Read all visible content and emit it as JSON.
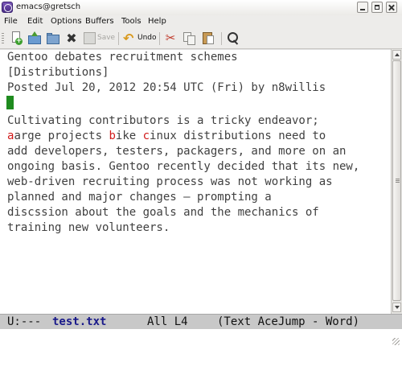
{
  "window": {
    "title": "emacs@gretsch"
  },
  "menu": [
    "File",
    "Edit",
    "Options",
    "Buffers",
    "Tools",
    "Help"
  ],
  "toolbar": {
    "save_label": "Save",
    "undo_label": "Undo",
    "kill_glyph": "✖",
    "cut_glyph": "✂"
  },
  "buffer": {
    "lines": [
      "Gentoo debates recruitment schemes",
      "[Distributions]",
      "Posted Jul 20, 2012 20:54 UTC (Fri) by n8willis",
      "",
      "Cultivating contributors is a tricky endeavor;",
      "aarge projects bike cinux distributions need to",
      "add developers, testers, packagers, and more on an",
      "ongoing basis. Gentoo recently decided that its new,",
      "web-driven recruiting process was not working as",
      "planned and major changes — prompting a",
      "discssion about the goals and the mechanics of",
      "training new volunteers."
    ],
    "jump_line": {
      "s1": "a",
      "t1": "arge projects ",
      "s2": "b",
      "t2": "ike ",
      "s3": "c",
      "t3": "inux distributions need to"
    }
  },
  "modeline": {
    "status": "U:---",
    "buffer_name": "test.txt",
    "position": "All L4",
    "modes": "(Text AceJump - Word)"
  },
  "colors": {
    "cursor": "#1f8b1f",
    "jump_marker": "#d11a1a",
    "modeline_bg": "#c8c8c8",
    "buffer_name": "#1a1a8a"
  }
}
